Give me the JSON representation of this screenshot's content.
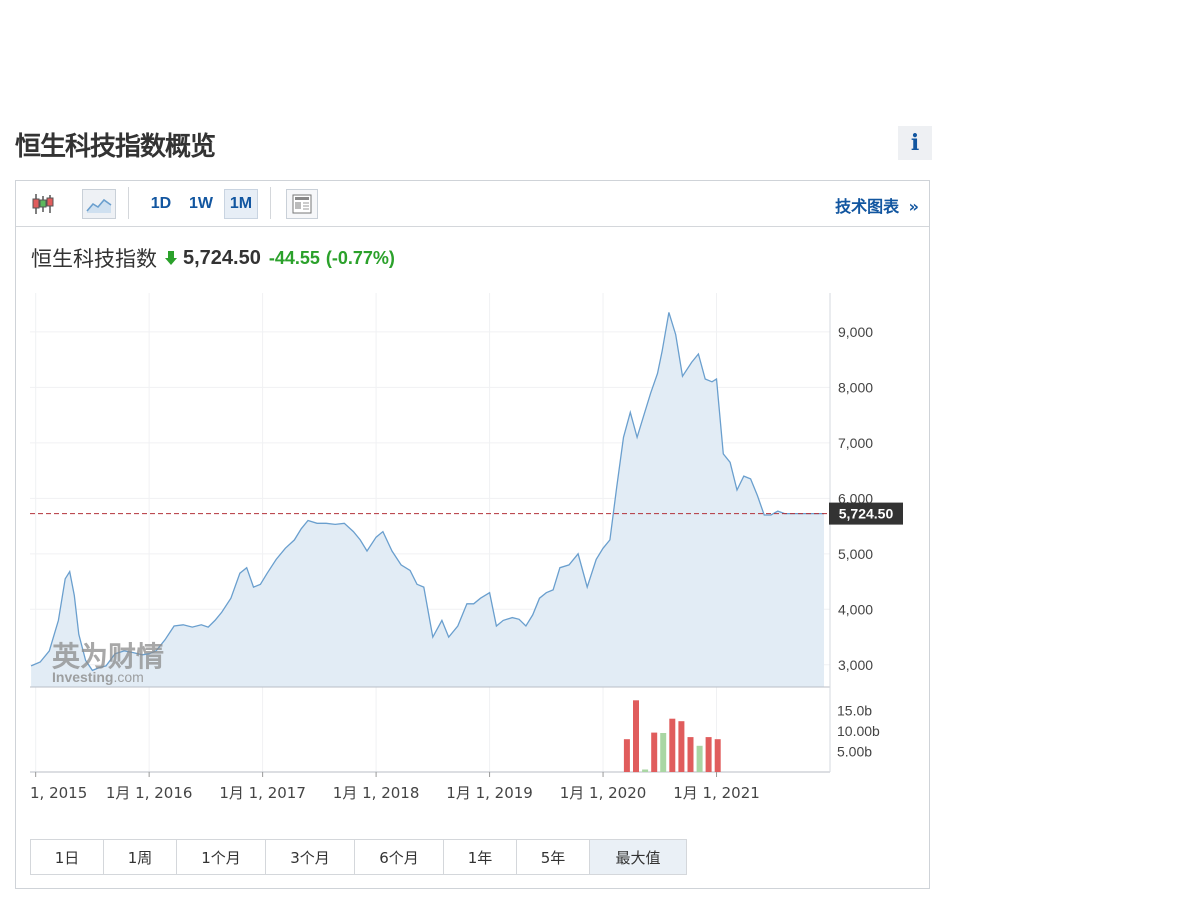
{
  "page_title": "恒生科技指数概览",
  "info_label": "i",
  "toolbar": {
    "candle_icon": "candlestick-icon",
    "area_icon": "area-chart-icon",
    "timeframes": [
      "1D",
      "1W",
      "1M"
    ],
    "active_timeframe": "1M",
    "layout_icon": "layout-icon",
    "tech_chart_link": "技术图表",
    "tech_chart_arrow": "»"
  },
  "quote": {
    "name": "恒生科技指数",
    "direction": "down",
    "price": "5,724.50",
    "change": "-44.55",
    "change_pct": "(-0.77%)"
  },
  "watermark": {
    "cn": "英为财情",
    "en": "Investing",
    "suffix": ".com"
  },
  "last_price_label": "5,724.50",
  "range_buttons": [
    "1日",
    "1周",
    "1个月",
    "3个月",
    "6个月",
    "1年",
    "5年",
    "最大值"
  ],
  "active_range": "最大值",
  "colors": {
    "line": "#6a9fce",
    "area": "#e2ecf5",
    "up": "#a9d6a3",
    "down": "#e05c5c",
    "change_text": "#2ba12b",
    "price_line": "#b3323a",
    "link": "#1256a0"
  },
  "chart_data": {
    "type": "area",
    "x_tick_labels": [
      "1, 2015",
      "1月 1, 2016",
      "1月 1, 2017",
      "1月 1, 2018",
      "1月 1, 2019",
      "1月 1, 2020",
      "1月 1, 2021"
    ],
    "x_tick_dates": [
      2015.0,
      2016.0,
      2017.0,
      2018.0,
      2019.0,
      2020.0,
      2021.0
    ],
    "x_range": [
      2014.95,
      2022.0
    ],
    "price_ticks": [
      "3,000",
      "4,000",
      "5,000",
      "6,000",
      "7,000",
      "8,000",
      "9,000"
    ],
    "price_tick_values": [
      3000,
      4000,
      5000,
      6000,
      7000,
      8000,
      9000
    ],
    "ylim": [
      2600,
      9700
    ],
    "volume_ticks": [
      "5.00b",
      "10.00b",
      "15.0b"
    ],
    "volume_tick_values": [
      5,
      10,
      15
    ],
    "volume_ylim": [
      0,
      20
    ],
    "last_price": 5724.5,
    "price_series": {
      "dates": [
        2014.96,
        2015.04,
        2015.12,
        2015.2,
        2015.26,
        2015.3,
        2015.34,
        2015.38,
        2015.44,
        2015.5,
        2015.56,
        2015.62,
        2015.7,
        2015.78,
        2015.86,
        2015.94,
        2016.0,
        2016.06,
        2016.14,
        2016.22,
        2016.3,
        2016.38,
        2016.46,
        2016.52,
        2016.58,
        2016.64,
        2016.72,
        2016.8,
        2016.86,
        2016.92,
        2016.98,
        2017.04,
        2017.12,
        2017.2,
        2017.28,
        2017.34,
        2017.4,
        2017.48,
        2017.56,
        2017.64,
        2017.72,
        2017.8,
        2017.86,
        2017.92,
        2018.0,
        2018.06,
        2018.14,
        2018.22,
        2018.3,
        2018.36,
        2018.42,
        2018.5,
        2018.58,
        2018.64,
        2018.72,
        2018.8,
        2018.86,
        2018.92,
        2019.0,
        2019.06,
        2019.12,
        2019.2,
        2019.26,
        2019.32,
        2019.38,
        2019.44,
        2019.5,
        2019.56,
        2019.62,
        2019.7,
        2019.78,
        2019.86,
        2019.94,
        2020.0,
        2020.06,
        2020.12,
        2020.18,
        2020.24,
        2020.3,
        2020.36,
        2020.42,
        2020.48,
        2020.52,
        2020.58,
        2020.64,
        2020.7,
        2020.78,
        2020.84,
        2020.9,
        2020.96,
        2021.0,
        2021.06,
        2021.12,
        2021.18,
        2021.24,
        2021.3,
        2021.36,
        2021.42,
        2021.48,
        2021.54,
        2021.6,
        2021.66,
        2021.72,
        2021.78,
        2021.84,
        2021.92,
        2021.98,
        2022.04
      ],
      "values": [
        2980,
        3050,
        3250,
        3800,
        4550,
        4680,
        4250,
        3550,
        3080,
        2900,
        2950,
        2980,
        3200,
        3250,
        3220,
        3180,
        3200,
        3250,
        3450,
        3700,
        3720,
        3680,
        3720,
        3680,
        3800,
        3950,
        4200,
        4650,
        4750,
        4400,
        4450,
        4650,
        4900,
        5100,
        5250,
        5450,
        5600,
        5550,
        5550,
        5530,
        5550,
        5400,
        5250,
        5050,
        5300,
        5400,
        5050,
        4800,
        4700,
        4450,
        4400,
        3500,
        3800,
        3500,
        3700,
        4100,
        4100,
        4200,
        4300,
        3700,
        3800,
        3850,
        3820,
        3700,
        3900,
        4200,
        4300,
        4350,
        4750,
        4800,
        5000,
        4400,
        4900,
        5100,
        5250,
        6200,
        7100,
        7550,
        7100,
        7500,
        7900,
        8250,
        8650,
        9350,
        8950,
        8200,
        8450,
        8600,
        8150,
        8100,
        8150,
        6800,
        6650,
        6150,
        6400,
        6350,
        6050,
        5700,
        5700,
        5770,
        5724.5,
        5724.5,
        5724.5,
        5724.5,
        5724.5,
        5724.5,
        5724.5,
        5724.5
      ]
    },
    "volume_series": {
      "dates": [
        2020.14,
        2020.22,
        2020.3,
        2020.38,
        2020.46,
        2020.54,
        2020.62,
        2020.7,
        2020.78,
        2020.86,
        2020.94,
        2021.02
      ],
      "values": [
        8.0,
        17.5,
        0.6,
        9.6,
        9.5,
        13.0,
        12.4,
        8.5,
        6.4,
        8.5,
        8.0,
        0
      ],
      "direction": [
        "down",
        "down",
        "up",
        "down",
        "up",
        "down",
        "down",
        "down",
        "up",
        "down",
        "down",
        "down"
      ]
    }
  }
}
